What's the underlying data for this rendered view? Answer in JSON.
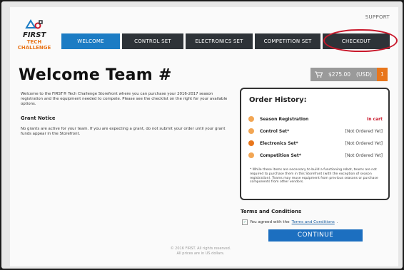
{
  "header": {
    "support_label": "SUPPORT",
    "logo": {
      "first": "FIRST",
      "tech": "TECH",
      "challenge": "CHALLENGE"
    }
  },
  "nav": {
    "tabs": [
      {
        "label": "WELCOME"
      },
      {
        "label": "CONTROL SET"
      },
      {
        "label": "ELECTRONICS SET"
      },
      {
        "label": "COMPETITION SET"
      },
      {
        "label": "CHECKOUT"
      }
    ],
    "active_tab": "WELCOME"
  },
  "main": {
    "title": "Welcome Team #",
    "intro": "Welcome to the FIRST® Tech Challenge Storefront where you can purchase your 2016-2017 season registration and the equipment needed to compete. Please see the checklist on the right for your available options.",
    "grant_heading": "Grant Notice",
    "grant_text": "No grants are active for your team. If you are expecting a grant, do not submit your order until your grant funds appear in the Storefront."
  },
  "cart": {
    "amount": "$275.00",
    "currency": "(USD)",
    "count": "1"
  },
  "order_history": {
    "title": "Order History:",
    "items": [
      {
        "label": "Season Registration",
        "status": "In cart"
      },
      {
        "label": "Control Set*",
        "status": "[Not Ordered Yet]"
      },
      {
        "label": "Electronics Set*",
        "status": "[Not Ordered Yet]"
      },
      {
        "label": "Competition Set*",
        "status": "[Not Ordered Yet]"
      }
    ],
    "note": "* While these items are necessary to build a functioning robot, teams are not required to purchase them in this Storefront (with the exception of season registration). Teams may reuse equipment from previous seasons or purchase components from other vendors."
  },
  "terms": {
    "heading": "Terms and Conditions",
    "agreed_prefix": "You agreed with the",
    "link": "Terms and Conditions",
    "suffix": "."
  },
  "continue_label": "CONTINUE",
  "footer": {
    "line1": "© 2016 FIRST. All rights reserved.",
    "line2": "All prices are in US dollars."
  },
  "colors": {
    "nav_active": "#1c7cc4",
    "nav_bg": "#2e3338",
    "accent_orange": "#e8761c",
    "in_cart_red": "#c9182b",
    "continue_blue": "#1c6fc0",
    "annotation_circle": "#c9182b"
  }
}
